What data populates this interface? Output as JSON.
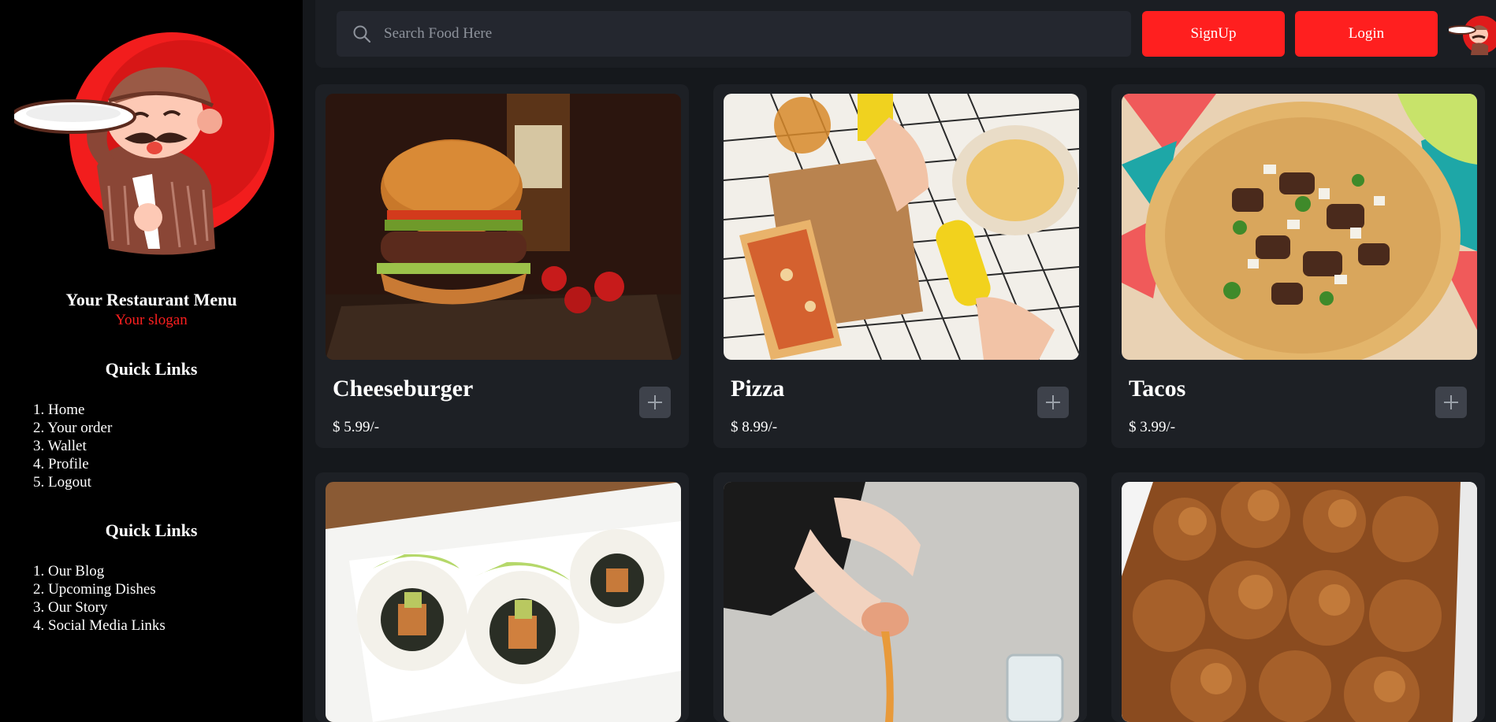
{
  "sidebar": {
    "logo_icon": "chef-mascot-logo",
    "brand_name": "Your Restaurant Menu",
    "slogan": "Your slogan",
    "quick_links_1": {
      "title": "Quick Links",
      "items": [
        "1. Home",
        "2. Your order",
        "3. Wallet",
        "4. Profile",
        "5. Logout"
      ]
    },
    "quick_links_2": {
      "title": "Quick Links",
      "items": [
        "1. Our Blog",
        "2. Upcoming Dishes",
        "3. Our Story",
        "4. Social Media Links"
      ]
    }
  },
  "header": {
    "search_placeholder": "Search Food Here",
    "search_icon": "search-icon",
    "signup_label": "SignUp",
    "login_label": "Login",
    "avatar_icon": "chef-avatar"
  },
  "menu": {
    "items": [
      {
        "name": "Cheeseburger",
        "price": "$ 5.99/-",
        "image": "cheeseburger-photo"
      },
      {
        "name": "Pizza",
        "price": "$ 8.99/-",
        "image": "pizza-photo"
      },
      {
        "name": "Tacos",
        "price": "$ 3.99/-",
        "image": "tacos-photo"
      },
      {
        "name": "",
        "price": "",
        "image": "sushi-photo"
      },
      {
        "name": "",
        "price": "",
        "image": "egg-cracking-photo"
      },
      {
        "name": "",
        "price": "",
        "image": "fried-chicken-photo"
      }
    ]
  },
  "colors": {
    "accent": "#ff1f1f",
    "page_bg": "#15181c",
    "card_bg": "#1d2025",
    "sidebar_bg": "#000000"
  }
}
